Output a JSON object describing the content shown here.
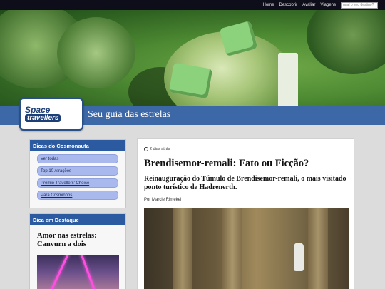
{
  "nav": {
    "links": [
      "Home",
      "Descobrir",
      "Avaliar",
      "Viagens"
    ],
    "search_placeholder": "qual o seu destino?"
  },
  "brand": {
    "logo_line1": "Space",
    "logo_line2": "travellers",
    "tagline": "Seu guia das estrelas"
  },
  "sidebar": {
    "tips_title": "Dicas do Cosmonauta",
    "tips": [
      "Ver todas",
      "Top 10 Atrações",
      "Prêmio Travellers' Choice",
      "Para Cosminhos"
    ],
    "featured_title": "Dica em Destaque",
    "featured_headline": "Amor nas estrelas: Canvurn a dois"
  },
  "article": {
    "time": "2 dias atrás",
    "title": "Brendisemor-remali: Fato ou Ficção?",
    "subtitle": "Reinauguração do Túmulo de Brendisemor-remali, o mais visitado ponto turístico de Hadrenerth.",
    "author": "Por Marcie Rimekei"
  }
}
